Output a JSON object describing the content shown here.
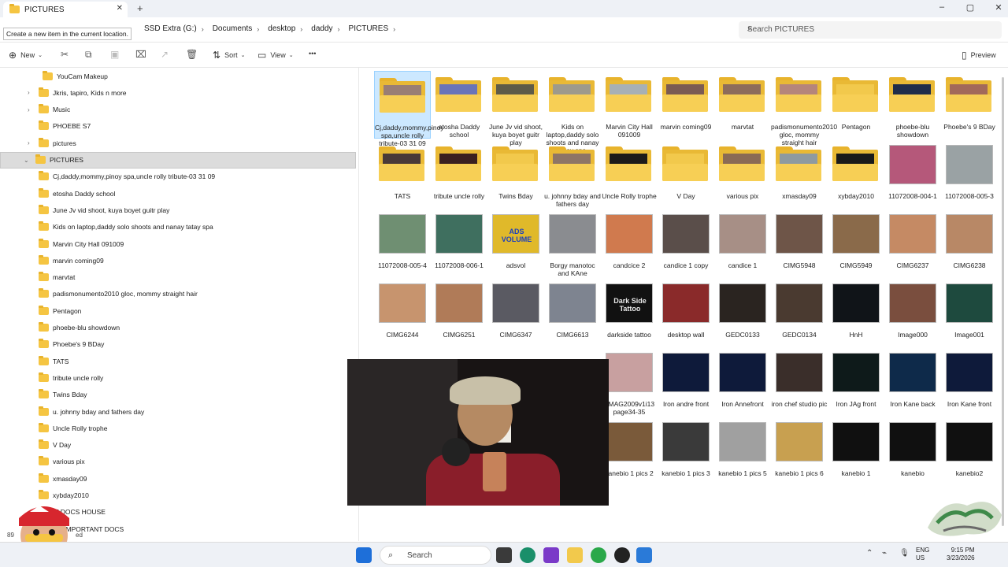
{
  "window": {
    "tab_title": "PICTURES",
    "new_tab": "+",
    "minimize": "–",
    "maximize": "▢",
    "close": "✕"
  },
  "address": {
    "tooltip": "Create a new item in the current location.",
    "crumbs": [
      "SSD Extra (G:)",
      "Documents",
      "desktop",
      "daddy",
      "PICTURES"
    ],
    "search_placeholder": "Search PICTURES"
  },
  "commands": {
    "new": "New",
    "sort": "Sort",
    "view": "View",
    "more": "•••",
    "preview": "Preview"
  },
  "nav": {
    "items": [
      {
        "label": "YouCam Makeup",
        "indent": 2,
        "arrow": ""
      },
      {
        "label": "Jkris, tapiro, Kids n more",
        "indent": 1,
        "arrow": ">"
      },
      {
        "label": "Music",
        "indent": 1,
        "arrow": ">"
      },
      {
        "label": "PHOEBE S7",
        "indent": 1,
        "arrow": ""
      },
      {
        "label": "pictures",
        "indent": 1,
        "arrow": ">"
      },
      {
        "label": "PICTURES",
        "indent": 0,
        "arrow": "v",
        "selected": true
      },
      {
        "label": "Cj,daddy,mommy,pinoy spa,uncle rolly tribute-03 31 09",
        "indent": 1,
        "arrow": ""
      },
      {
        "label": "etosha Daddy school",
        "indent": 1,
        "arrow": ""
      },
      {
        "label": "June Jv vid shoot, kuya boyet guitr play",
        "indent": 1,
        "arrow": ""
      },
      {
        "label": "Kids on laptop,daddy solo shoots and nanay tatay spa",
        "indent": 1,
        "arrow": ""
      },
      {
        "label": "Marvin City Hall 091009",
        "indent": 1,
        "arrow": ""
      },
      {
        "label": "marvin coming09",
        "indent": 1,
        "arrow": ""
      },
      {
        "label": "marvtat",
        "indent": 1,
        "arrow": ""
      },
      {
        "label": "padismonumento2010 gloc, mommy straight hair",
        "indent": 1,
        "arrow": ""
      },
      {
        "label": "Pentagon",
        "indent": 1,
        "arrow": ""
      },
      {
        "label": "phoebe-blu showdown",
        "indent": 1,
        "arrow": ""
      },
      {
        "label": "Phoebe's 9 BDay",
        "indent": 1,
        "arrow": ""
      },
      {
        "label": "TATS",
        "indent": 1,
        "arrow": ""
      },
      {
        "label": "tribute uncle rolly",
        "indent": 1,
        "arrow": ""
      },
      {
        "label": "Twins Bday",
        "indent": 1,
        "arrow": ""
      },
      {
        "label": "u. johnny bday and fathers day",
        "indent": 1,
        "arrow": ""
      },
      {
        "label": "Uncle Rolly trophe",
        "indent": 1,
        "arrow": ""
      },
      {
        "label": "V Day",
        "indent": 1,
        "arrow": ""
      },
      {
        "label": "various pix",
        "indent": 1,
        "arrow": ""
      },
      {
        "label": "xmasday09",
        "indent": 1,
        "arrow": ""
      },
      {
        "label": "xybday2010",
        "indent": 1,
        "arrow": ""
      },
      {
        "label": "IT DOCS HOUSE",
        "indent": 1,
        "arrow": ""
      },
      {
        "label": "NE IMPORTANT DOCS",
        "indent": 1,
        "arrow": ""
      }
    ]
  },
  "status": {
    "count_fragment": "89",
    "selected_fragment": "ed"
  },
  "grid": {
    "folders": [
      {
        "label": "Cj,daddy,mommy,pinoy spa,uncle rolly tribute-03 31 09",
        "selected": true,
        "photo": "#9a7e74"
      },
      {
        "label": "etosha Daddy school",
        "photo": "#6a74b8"
      },
      {
        "label": "June Jv vid shoot, kuya boyet guitr play",
        "photo": "#5e5b48"
      },
      {
        "label": "Kids on laptop,daddy solo shoots and nanay tatay spa",
        "photo": "#9e9a8c"
      },
      {
        "label": "Marvin City Hall 091009",
        "photo": "#a7b0b5"
      },
      {
        "label": "marvin coming09",
        "photo": "#7b5b53"
      },
      {
        "label": "marvtat",
        "photo": "#8d6c5b"
      },
      {
        "label": "padismonumento2010 gloc, mommy straight hair",
        "photo": "#b5857b"
      },
      {
        "label": "Pentagon",
        "photo": "#f2c94c"
      },
      {
        "label": "phoebe-blu showdown",
        "photo": "#1f2d4a"
      },
      {
        "label": "Phoebe's 9 BDay",
        "photo": "#a2695a"
      },
      {
        "label": "TATS",
        "photo": "#4a3a38"
      },
      {
        "label": "tribute uncle rolly",
        "photo": "#3a2020"
      },
      {
        "label": "Twins Bday",
        "photo": "#f2c94c"
      },
      {
        "label": "u. johnny bday and fathers day",
        "photo": "#8e7566"
      },
      {
        "label": "Uncle Rolly trophe",
        "photo": "#1c1a1a"
      },
      {
        "label": "V Day",
        "photo": "#f2c94c"
      },
      {
        "label": "various pix",
        "photo": "#8a6a55"
      },
      {
        "label": "xmasday09",
        "photo": "#8e9aa0"
      },
      {
        "label": "xybday2010",
        "photo": "#1a1a1a"
      }
    ],
    "images": [
      {
        "label": "11072008-004-1",
        "color": "#b5587a"
      },
      {
        "label": "11072008-005-3",
        "color": "#9aa2a4"
      },
      {
        "label": "11072008-005-4",
        "color": "#6f8f72"
      },
      {
        "label": "11072008-006-1",
        "color": "#3f6f5f"
      },
      {
        "label": "adsvol",
        "color": "#e0b92a",
        "text": "ADS VOLUME"
      },
      {
        "label": "Borgy manotoc and KAne",
        "color": "#8a8c90"
      },
      {
        "label": "candcice 2",
        "color": "#d07a4e"
      },
      {
        "label": "candice 1 copy",
        "color": "#5a4e4a"
      },
      {
        "label": "candice 1",
        "color": "#a78f86"
      },
      {
        "label": "CIMG5948",
        "color": "#6e5548"
      },
      {
        "label": "CIMG5949",
        "color": "#8a6a4a"
      },
      {
        "label": "CIMG6237",
        "color": "#c58a64"
      },
      {
        "label": "CIMG6238",
        "color": "#b88866"
      },
      {
        "label": "CIMG6244",
        "color": "#c7946e"
      },
      {
        "label": "CIMG6251",
        "color": "#b07b58"
      },
      {
        "label": "CIMG6347",
        "color": "#5a5a62"
      },
      {
        "label": "CIMG6613",
        "color": "#7e8490"
      },
      {
        "label": "darkside tattoo",
        "color": "#111111",
        "text": "Dark Side Tattoo"
      },
      {
        "label": "desktop wall",
        "color": "#8a2a2a"
      },
      {
        "label": "GEDC0133",
        "color": "#2a2420"
      },
      {
        "label": "GEDC0134",
        "color": "#4a3a30"
      },
      {
        "label": "HnH",
        "color": "#101418"
      },
      {
        "label": "Image000",
        "color": "#7a4e3e"
      },
      {
        "label": "Image001",
        "color": "#1e4a3e"
      },
      {
        "label": "",
        "color": "#1a1a1a",
        "hidden": true
      },
      {
        "label": "",
        "color": "#1a1a1a",
        "hidden": true
      },
      {
        "label": "",
        "color": "#1a1a1a",
        "hidden": true
      },
      {
        "label": "",
        "color": "#1a1a1a",
        "hidden": true
      },
      {
        "label": "PMAG2009v1i13 page34-35",
        "color": "#c8a0a0"
      },
      {
        "label": "Iron andre front",
        "color": "#0e1a3a"
      },
      {
        "label": "Iron Annefront",
        "color": "#0e1a3a"
      },
      {
        "label": "iron chef studio pic",
        "color": "#3a2e2a"
      },
      {
        "label": "Iron JAg front",
        "color": "#0e1a1a"
      },
      {
        "label": "Iron Kane back",
        "color": "#0e2a4a"
      },
      {
        "label": "Iron Kane front",
        "color": "#0e1a3a"
      },
      {
        "label": "",
        "color": "#1a1a1a",
        "hidden": true
      },
      {
        "label": "",
        "color": "#1a1a1a",
        "hidden": true
      },
      {
        "label": "",
        "color": "#1a1a1a",
        "hidden": true
      },
      {
        "label": "",
        "color": "#1a1a1a",
        "hidden": true
      },
      {
        "label": "kanebio 1 pics 2",
        "color": "#7a5a3a"
      },
      {
        "label": "kanebio 1 pics 3",
        "color": "#3a3a3a"
      },
      {
        "label": "kanebio 1 pics 5",
        "color": "#a0a0a0"
      },
      {
        "label": "kanebio 1 pics 6",
        "color": "#c8a050"
      },
      {
        "label": "kanebio 1",
        "color": "#101010"
      },
      {
        "label": "kanebio",
        "color": "#101010"
      },
      {
        "label": "kanebio2",
        "color": "#101010"
      }
    ]
  },
  "taskbar": {
    "search": "Search",
    "lang_line1": "ENG",
    "lang_line2": "US",
    "time": "9:15 PM",
    "date": "3/23/2026"
  }
}
